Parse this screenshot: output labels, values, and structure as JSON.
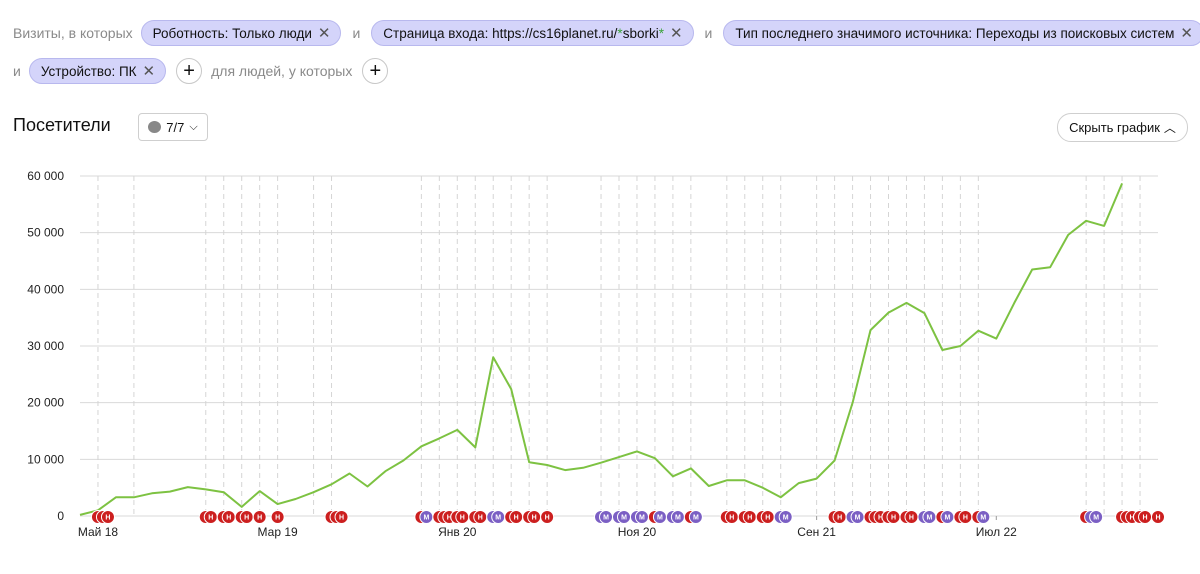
{
  "filters": {
    "prefix": "Визиты, в которых",
    "connector": "и",
    "chips": [
      {
        "label": "Роботность: Только люди"
      },
      {
        "label_pre": "Страница входа: https://cs16planet.ru/",
        "label_hl1": "*",
        "label_mid": "sborki",
        "label_hl2": "*"
      },
      {
        "label": "Тип последнего значимого источника: Переходы из поисковых систем"
      },
      {
        "label": "Устройство: ПК"
      }
    ],
    "people_text": "для людей, у которых",
    "remove_icon": "close-icon",
    "add_icon": "plus-icon"
  },
  "panel": {
    "title": "Посетители",
    "notes_count": "7/7",
    "hide_chart_label": "Скрыть график"
  },
  "chart_data": {
    "type": "line",
    "title": "",
    "series": [
      {
        "color": "#7dc242",
        "x_months": [
          "2018-04",
          "2018-05",
          "2018-06",
          "2018-07",
          "2018-08",
          "2018-09",
          "2018-10",
          "2018-11",
          "2018-12",
          "2019-01",
          "2019-02",
          "2019-03",
          "2019-04",
          "2019-05",
          "2019-06",
          "2019-07",
          "2019-08",
          "2019-09",
          "2019-10",
          "2019-11",
          "2019-12",
          "2020-01",
          "2020-02",
          "2020-03",
          "2020-04",
          "2020-05",
          "2020-06",
          "2020-07",
          "2020-08",
          "2020-09",
          "2020-10",
          "2020-11",
          "2020-12",
          "2021-01",
          "2021-02",
          "2021-03",
          "2021-04",
          "2021-05",
          "2021-06",
          "2021-07",
          "2021-08",
          "2021-09",
          "2021-10",
          "2021-11",
          "2021-12",
          "2022-01",
          "2022-02",
          "2022-03",
          "2022-04",
          "2022-05",
          "2022-06",
          "2022-07",
          "2022-08",
          "2022-09",
          "2022-10",
          "2022-11",
          "2022-12",
          "2023-01",
          "2023-02",
          "2023-03",
          "2023-04"
        ],
        "values": [
          200,
          1000,
          3300,
          3300,
          4000,
          4300,
          5100,
          4700,
          4200,
          1600,
          4400,
          2100,
          3000,
          4200,
          5600,
          7500,
          5200,
          7900,
          9800,
          12300,
          13700,
          15200,
          12100,
          28000,
          22400,
          9500,
          9000,
          8100,
          8500,
          9400,
          10400,
          11400,
          10200,
          7000,
          8400,
          5300,
          6300,
          6300,
          5000,
          3300,
          5800,
          6600,
          9800,
          20000,
          32800,
          35900,
          37600,
          35800,
          29300,
          30000,
          32700,
          31300,
          37600,
          43500,
          43900,
          49600,
          52100,
          51200,
          58700
        ]
      }
    ],
    "x_tick_labels": [
      "Май 18",
      "Мар 19",
      "Янв 20",
      "Ноя 20",
      "Сен 21",
      "Июл 22"
    ],
    "y_tick_labels": [
      "0",
      "10 000",
      "20 000",
      "30 000",
      "40 000",
      "50 000",
      "60 000"
    ],
    "ylim": [
      0,
      60000
    ],
    "grid": true,
    "marker_letters": {
      "note": "Н",
      "memo": "М"
    },
    "marker_colors": {
      "red": "#cc1f1f",
      "purple": "#7b5fc4"
    }
  }
}
